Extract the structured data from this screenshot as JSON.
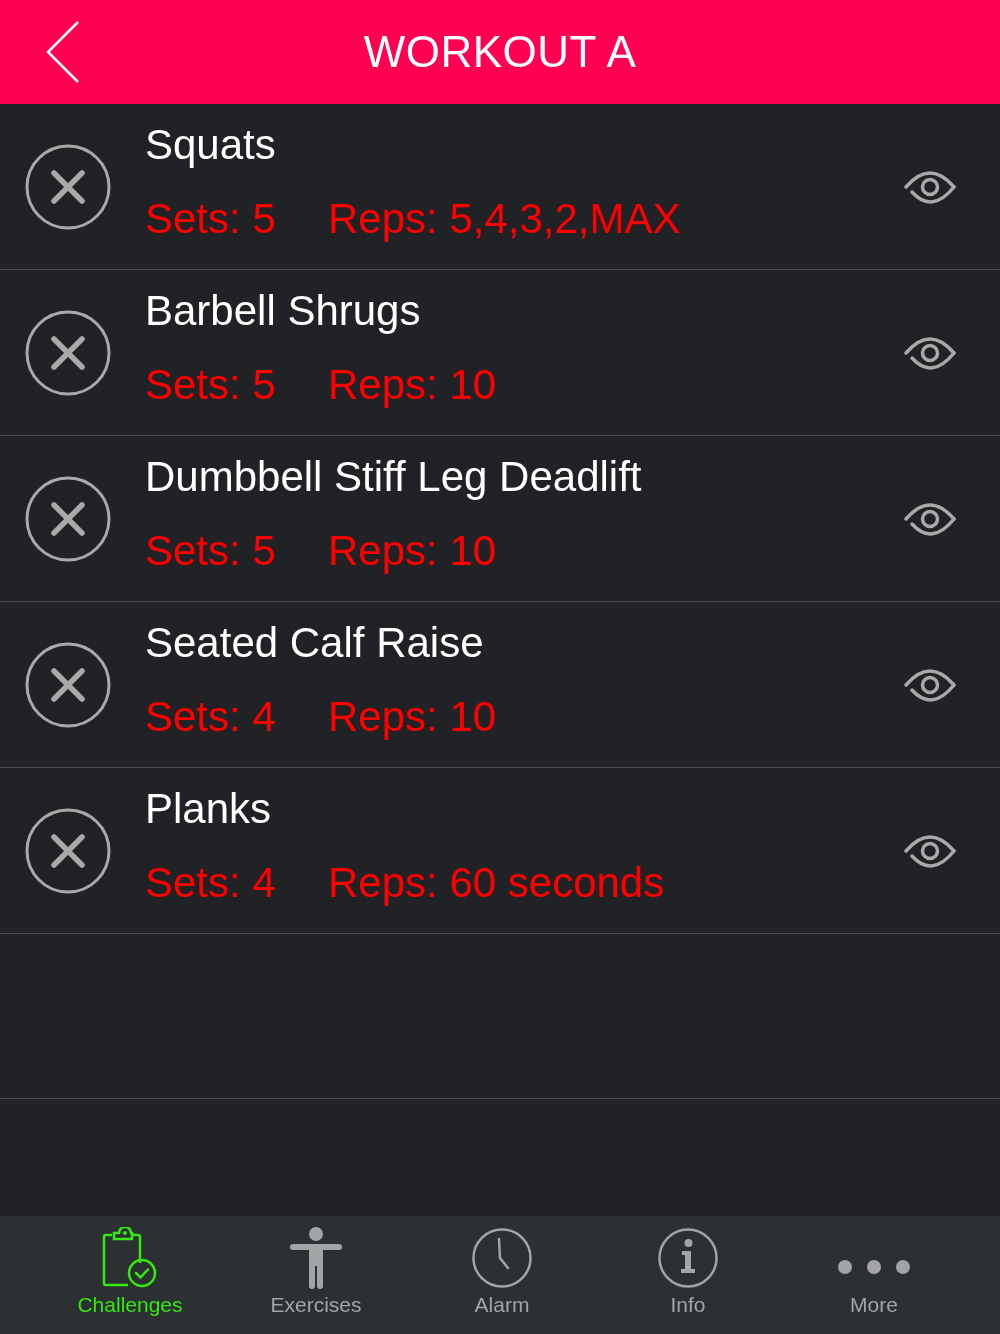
{
  "header": {
    "title": "WORKOUT A"
  },
  "exercises": [
    {
      "name": "Squats",
      "sets": "Sets: 5",
      "reps": "Reps: 5,4,3,2,MAX"
    },
    {
      "name": "Barbell Shrugs",
      "sets": "Sets: 5",
      "reps": "Reps: 10"
    },
    {
      "name": "Dumbbell Stiff Leg Deadlift",
      "sets": "Sets: 5",
      "reps": "Reps: 10"
    },
    {
      "name": "Seated Calf Raise",
      "sets": "Sets: 4",
      "reps": "Reps: 10"
    },
    {
      "name": "Planks",
      "sets": "Sets: 4",
      "reps": "Reps: 60 seconds"
    }
  ],
  "tab_bar": [
    {
      "label": "Challenges",
      "kind": "clipboard",
      "selected": true
    },
    {
      "label": "Exercises",
      "kind": "figure",
      "selected": false
    },
    {
      "label": "Alarm",
      "kind": "clock",
      "selected": false
    },
    {
      "label": "Info",
      "kind": "info",
      "selected": false
    },
    {
      "label": "More",
      "kind": "dots",
      "selected": false
    }
  ]
}
